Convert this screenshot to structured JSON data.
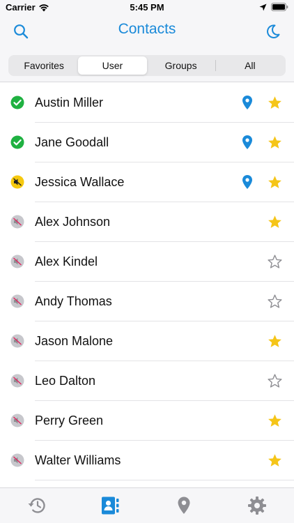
{
  "status_bar": {
    "carrier": "Carrier",
    "time": "5:45 PM"
  },
  "nav": {
    "title": "Contacts",
    "left_icon": "search-icon",
    "right_icon": "moon-icon"
  },
  "segments": [
    {
      "label": "Favorites",
      "active": false
    },
    {
      "label": "User",
      "active": true
    },
    {
      "label": "Groups",
      "active": false
    },
    {
      "label": "All",
      "active": false
    }
  ],
  "contacts": [
    {
      "name": "Austin Miller",
      "status": "online",
      "location": true,
      "favorite": true
    },
    {
      "name": "Jane Goodall",
      "status": "online",
      "location": true,
      "favorite": true
    },
    {
      "name": "Jessica Wallace",
      "status": "muted",
      "location": true,
      "favorite": true
    },
    {
      "name": "Alex Johnson",
      "status": "offline",
      "location": false,
      "favorite": true
    },
    {
      "name": "Alex Kindel",
      "status": "offline",
      "location": false,
      "favorite": false
    },
    {
      "name": "Andy Thomas",
      "status": "offline",
      "location": false,
      "favorite": false
    },
    {
      "name": "Jason Malone",
      "status": "offline",
      "location": false,
      "favorite": true
    },
    {
      "name": "Leo Dalton",
      "status": "offline",
      "location": false,
      "favorite": false
    },
    {
      "name": "Perry Green",
      "status": "offline",
      "location": false,
      "favorite": true
    },
    {
      "name": "Walter Williams",
      "status": "offline",
      "location": false,
      "favorite": true
    }
  ],
  "tabs": [
    {
      "icon": "history-icon",
      "active": false
    },
    {
      "icon": "contacts-book-icon",
      "active": true
    },
    {
      "icon": "location-pin-icon",
      "active": false
    },
    {
      "icon": "gear-icon",
      "active": false
    }
  ],
  "colors": {
    "accent": "#1a8ad9",
    "online": "#1fb141",
    "muted": "#f6c90e",
    "star": "#f5c518",
    "inactive": "#8e8e93"
  }
}
